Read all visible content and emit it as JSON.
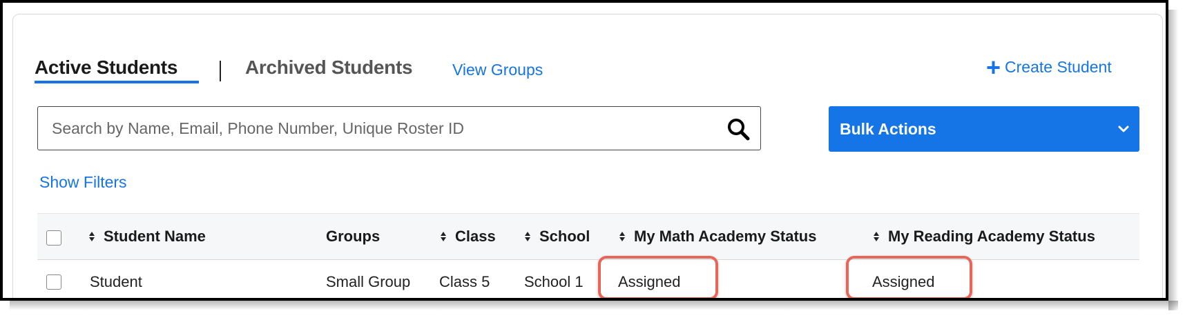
{
  "tabs": {
    "active": "Active Students",
    "separator": "|",
    "archived": "Archived Students",
    "view_groups": "View Groups"
  },
  "actions": {
    "create_student_icon": "+",
    "create_student": "Create Student",
    "bulk_actions": "Bulk Actions",
    "show_filters": "Show Filters"
  },
  "search": {
    "placeholder": "Search by Name, Email, Phone Number, Unique Roster ID",
    "value": ""
  },
  "colors": {
    "accent": "#1574e6",
    "highlight": "#e8655a"
  },
  "table": {
    "columns": [
      "Student Name",
      "Groups",
      "Class",
      "School",
      "My Math Academy Status",
      "My Reading Academy Status"
    ],
    "rows": [
      {
        "student_name": "Student",
        "groups": "Small Group",
        "class": "Class 5",
        "school": "School 1",
        "math_status": "Assigned",
        "reading_status": "Assigned"
      }
    ]
  }
}
